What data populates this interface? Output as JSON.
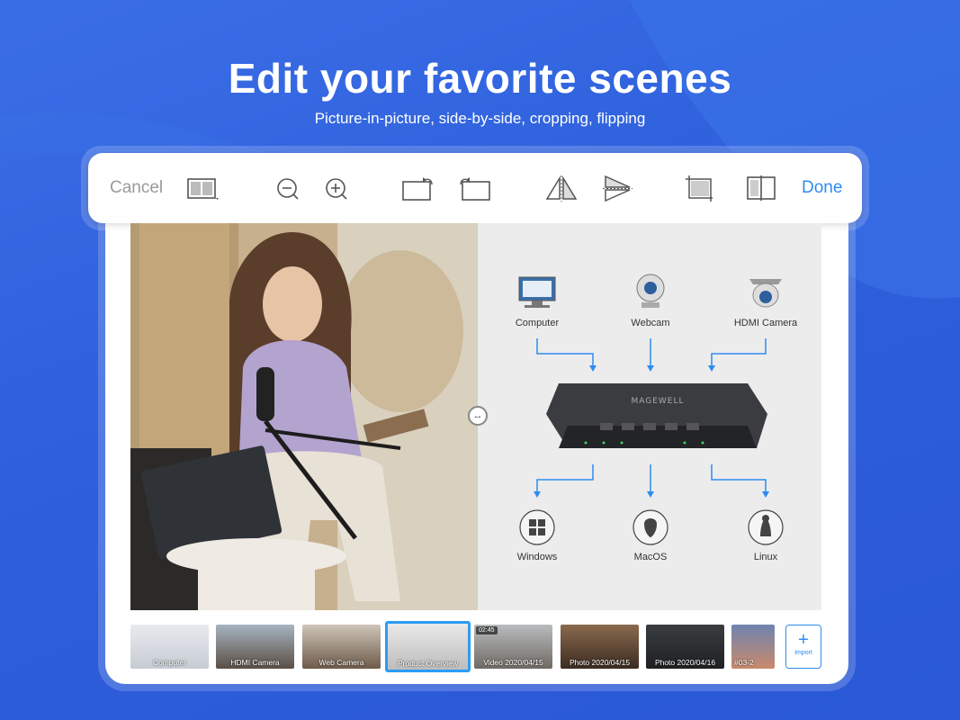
{
  "hero": {
    "title": "Edit your favorite scenes",
    "subtitle": "Picture-in-picture, side-by-side, cropping, flipping"
  },
  "toolbar": {
    "cancel_label": "Cancel",
    "done_label": "Done",
    "icons": [
      "layout-icon",
      "zoom-out-icon",
      "zoom-in-icon",
      "rotate-left-icon",
      "rotate-right-icon",
      "flip-horizontal-icon",
      "flip-vertical-icon",
      "crop-icon",
      "split-view-icon"
    ]
  },
  "diagram": {
    "brand": "MAGEWELL",
    "inputs": [
      "Computer",
      "Webcam",
      "HDMI Camera"
    ],
    "outputs": [
      "Windows",
      "MacOS",
      "Linux"
    ]
  },
  "scenes": [
    {
      "label": "Computer"
    },
    {
      "label": "HDMI Camera"
    },
    {
      "label": "Web Camera"
    },
    {
      "label": "Product Overview",
      "selected": true
    },
    {
      "label": "Video 2020/04/15",
      "time": "02:45"
    },
    {
      "label": "Photo 2020/04/15"
    },
    {
      "label": "Photo 2020/04/16"
    },
    {
      "label": "#03-2"
    }
  ],
  "import": {
    "plus": "+",
    "label": "Import"
  },
  "colors": {
    "accent": "#2d8cf0",
    "background": "#3063dd",
    "selected_border": "#2d9cf5"
  }
}
